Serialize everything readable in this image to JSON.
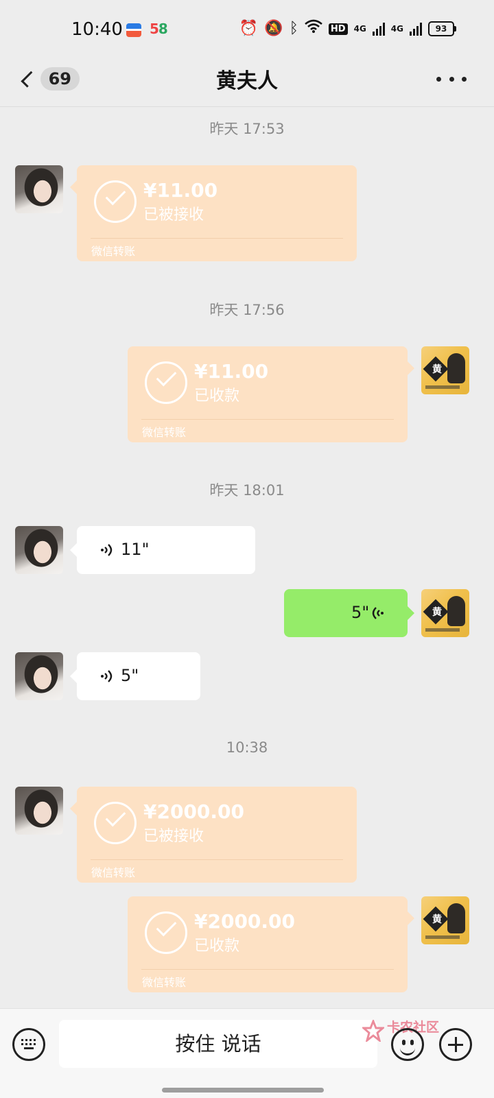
{
  "status_bar": {
    "time": "10:40",
    "app_badge": "58",
    "hd_label": "HD",
    "net1": "4G",
    "net2": "4G",
    "battery": "93"
  },
  "nav": {
    "unread_count": "69",
    "title": "黄夫人"
  },
  "messages": [
    {
      "type": "timestamp",
      "text": "昨天 17:53"
    },
    {
      "type": "transfer",
      "side": "left",
      "amount": "¥11.00",
      "status": "已被接收",
      "footer": "微信转账"
    },
    {
      "type": "timestamp",
      "text": "昨天 17:56"
    },
    {
      "type": "transfer",
      "side": "right",
      "amount": "¥11.00",
      "status": "已收款",
      "footer": "微信转账"
    },
    {
      "type": "timestamp",
      "text": "昨天 18:01"
    },
    {
      "type": "voice",
      "side": "left",
      "duration": "11\""
    },
    {
      "type": "voice",
      "side": "right",
      "duration": "5\""
    },
    {
      "type": "voice",
      "side": "left",
      "duration": "5\""
    },
    {
      "type": "timestamp",
      "text": "10:38"
    },
    {
      "type": "transfer",
      "side": "left",
      "amount": "¥2000.00",
      "status": "已被接收",
      "footer": "微信转账"
    },
    {
      "type": "transfer",
      "side": "right",
      "amount": "¥2000.00",
      "status": "已收款",
      "footer": "微信转账"
    }
  ],
  "avatar_me_char": "黄",
  "input_bar": {
    "hold_to_talk": "按住 说话"
  },
  "watermark": {
    "text": "卡农社区"
  },
  "colors": {
    "background": "#ededed",
    "transfer_bubble": "#fde1c4",
    "voice_self": "#95ec69",
    "voice_other": "#ffffff"
  }
}
